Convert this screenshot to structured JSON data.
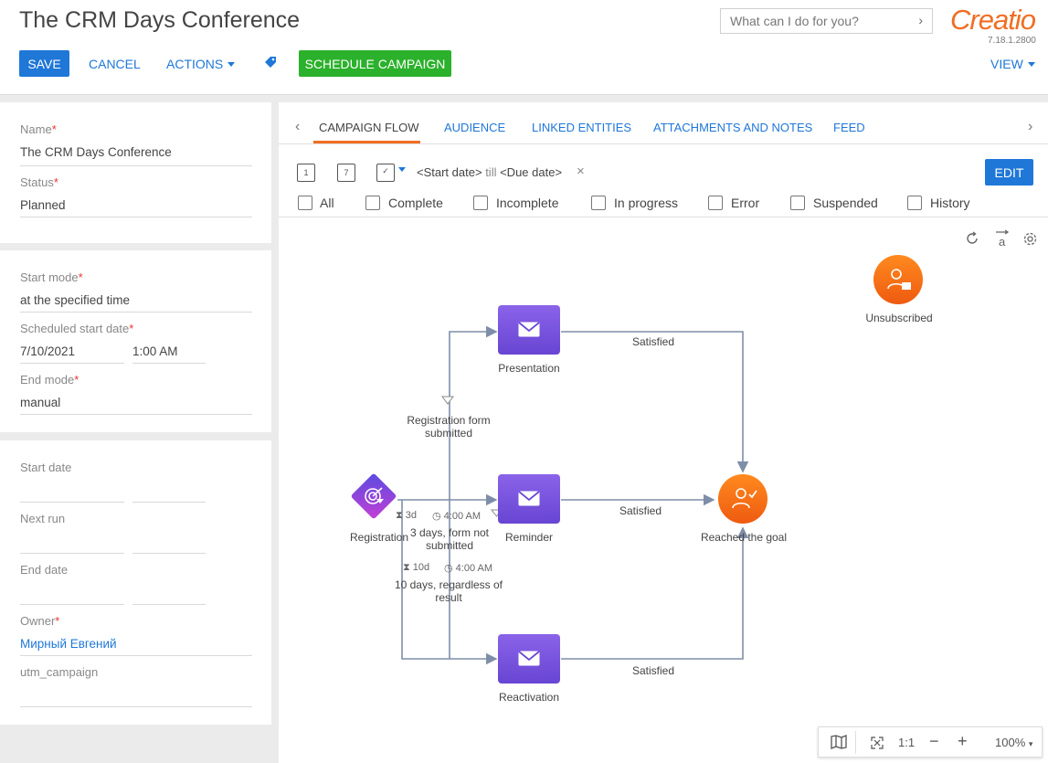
{
  "header": {
    "title": "The CRM Days Conference",
    "save": "SAVE",
    "cancel": "CANCEL",
    "actions": "ACTIONS",
    "schedule": "SCHEDULE CAMPAIGN",
    "view": "VIEW",
    "search_placeholder": "What can I do for you?",
    "logo": "Creatio",
    "version": "7.18.1.2800"
  },
  "left": {
    "name_label": "Name",
    "name_value": "The CRM Days Conference",
    "status_label": "Status",
    "status_value": "Planned",
    "start_mode_label": "Start mode",
    "start_mode_value": "at the specified time",
    "scheduled_label": "Scheduled start date",
    "scheduled_date": "7/10/2021",
    "scheduled_time": "1:00 AM",
    "end_mode_label": "End mode",
    "end_mode_value": "manual",
    "start_date_label": "Start date",
    "next_run_label": "Next run",
    "end_date_label": "End date",
    "owner_label": "Owner",
    "owner_value": "Мирный Евгений",
    "utm_label": "utm_campaign"
  },
  "tabs": [
    "CAMPAIGN FLOW",
    "AUDIENCE",
    "LINKED ENTITIES",
    "ATTACHMENTS AND NOTES",
    "FEED"
  ],
  "filter": {
    "cal_day": "1",
    "cal_week": "7",
    "start": "<Start date>",
    "till": "till",
    "due": "<Due date>",
    "edit": "EDIT",
    "checks": [
      "All",
      "Complete",
      "Incomplete",
      "In progress",
      "Error",
      "Suspended",
      "History"
    ]
  },
  "flow": {
    "presentation": "Presentation",
    "reminder": "Reminder",
    "reactivation": "Reactivation",
    "registration": "Registration",
    "goal": "Reached the goal",
    "unsubscribed": "Unsubscribed",
    "satisfied": "Satisfied",
    "reg_form_1": "Registration form",
    "reg_form_2": "submitted",
    "timer1_dur": "3d",
    "timer1_time": "4:00 AM",
    "timer1_label_1": "3 days, form not",
    "timer1_label_2": "submitted",
    "timer2_dur": "10d",
    "timer2_time": "4:00 AM",
    "timer2_label_1": "10 days, regardless of",
    "timer2_label_2": "result"
  },
  "zoom": {
    "ratio": "1:1",
    "level": "100%"
  },
  "colors": {
    "primary": "#1f77d8",
    "success": "#2bb12b",
    "accent": "#f06e23",
    "email": "#7b55e0"
  }
}
